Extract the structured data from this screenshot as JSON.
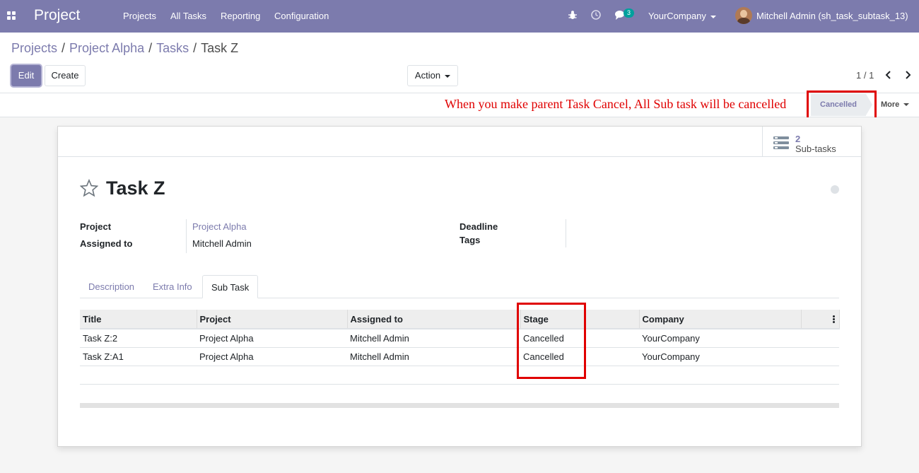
{
  "navbar": {
    "brand": "Project",
    "menus": [
      "Projects",
      "All Tasks",
      "Reporting",
      "Configuration"
    ],
    "message_count": "3",
    "company": "YourCompany",
    "user": "Mitchell Admin (sh_task_subtask_13)",
    "bg_color": "#7c7bad"
  },
  "breadcrumb": {
    "items": [
      "Projects",
      "Project Alpha",
      "Tasks"
    ],
    "current": "Task Z"
  },
  "controls": {
    "edit": "Edit",
    "create": "Create",
    "action": "Action",
    "pager": "1 / 1"
  },
  "statusbar": {
    "annotation": "When you make parent Task Cancel, All Sub task will be cancelled",
    "stage": "Cancelled",
    "more": "More"
  },
  "sheet": {
    "subtasks_count": "2",
    "subtasks_label": "Sub-tasks",
    "title": "Task Z",
    "fields": {
      "project_label": "Project",
      "project_value": "Project Alpha",
      "assigned_label": "Assigned to",
      "assigned_value": "Mitchell Admin",
      "deadline_label": "Deadline",
      "tags_label": "Tags"
    },
    "tabs": [
      "Description",
      "Extra Info",
      "Sub Task"
    ],
    "table": {
      "headers": [
        "Title",
        "Project",
        "Assigned to",
        "Stage",
        "Company"
      ],
      "rows": [
        [
          "Task Z:2",
          "Project Alpha",
          "Mitchell Admin",
          "Cancelled",
          "YourCompany"
        ],
        [
          "Task Z:A1",
          "Project Alpha",
          "Mitchell Admin",
          "Cancelled",
          "YourCompany"
        ]
      ]
    }
  },
  "colors": {
    "accent": "#7c7bad",
    "annotation": "#e00000"
  }
}
